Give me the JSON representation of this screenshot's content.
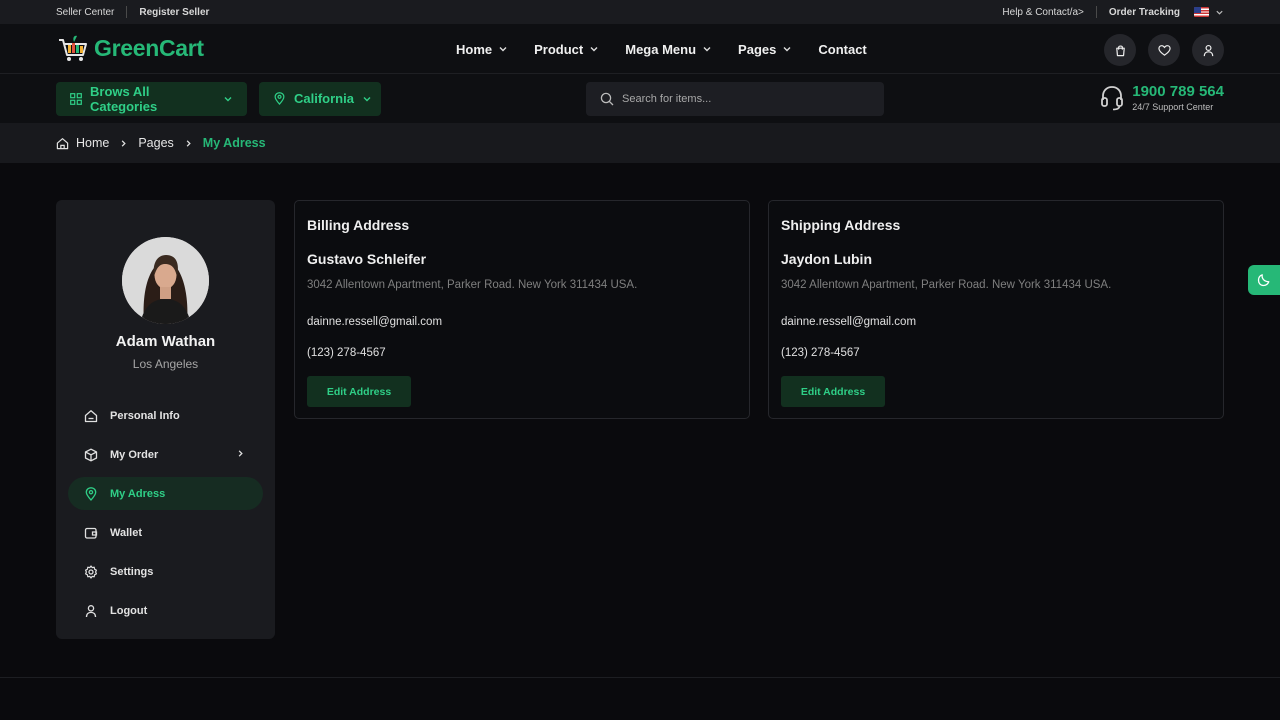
{
  "topbar": {
    "seller_center": "Seller Center",
    "register_seller": "Register Seller",
    "help_contact": "Help & Contact/a>",
    "order_tracking": "Order Tracking"
  },
  "header": {
    "logo_text": "GreenCart",
    "nav": [
      {
        "label": "Home",
        "has_dropdown": true
      },
      {
        "label": "Product",
        "has_dropdown": true
      },
      {
        "label": "Mega Menu",
        "has_dropdown": true
      },
      {
        "label": "Pages",
        "has_dropdown": true
      },
      {
        "label": "Contact",
        "has_dropdown": false
      }
    ],
    "icons": [
      "shopping-bag-icon",
      "heart-icon",
      "user-icon"
    ]
  },
  "subheader": {
    "categories_label": "Brows All Categories",
    "location_label": "California",
    "search_placeholder": "Search for items...",
    "support_phone": "1900 789 564",
    "support_label": "24/7 Support Center"
  },
  "breadcrumb": {
    "items": [
      "Home",
      "Pages",
      "My Adress"
    ]
  },
  "sidebar": {
    "user_name": "Adam Wathan",
    "user_location": "Los Angeles",
    "menu": [
      {
        "label": "Personal Info",
        "icon": "home-icon"
      },
      {
        "label": "My Order",
        "icon": "box-icon"
      },
      {
        "label": "My Adress",
        "icon": "map-pin-icon",
        "active": true
      },
      {
        "label": "Wallet",
        "icon": "wallet-icon"
      },
      {
        "label": "Settings",
        "icon": "gear-icon"
      },
      {
        "label": "Logout",
        "icon": "user-icon"
      }
    ]
  },
  "billing": {
    "title": "Billing Address",
    "name": "Gustavo Schleifer",
    "address": "3042 Allentown Apartment, Parker Road. New York 311434 USA.",
    "email": "dainne.ressell@gmail.com",
    "phone": "(123) 278-4567",
    "button": "Edit Address"
  },
  "shipping": {
    "title": "Shipping Address",
    "name": "Jaydon Lubin",
    "address": "3042 Allentown Apartment, Parker Road. New York 311434 USA.",
    "email": "dainne.ressell@gmail.com",
    "phone": "(123) 278-4567",
    "button": "Edit Address"
  },
  "colors": {
    "accent": "#26b877",
    "background": "#0a0a0d",
    "panel": "#1a1b1f"
  }
}
